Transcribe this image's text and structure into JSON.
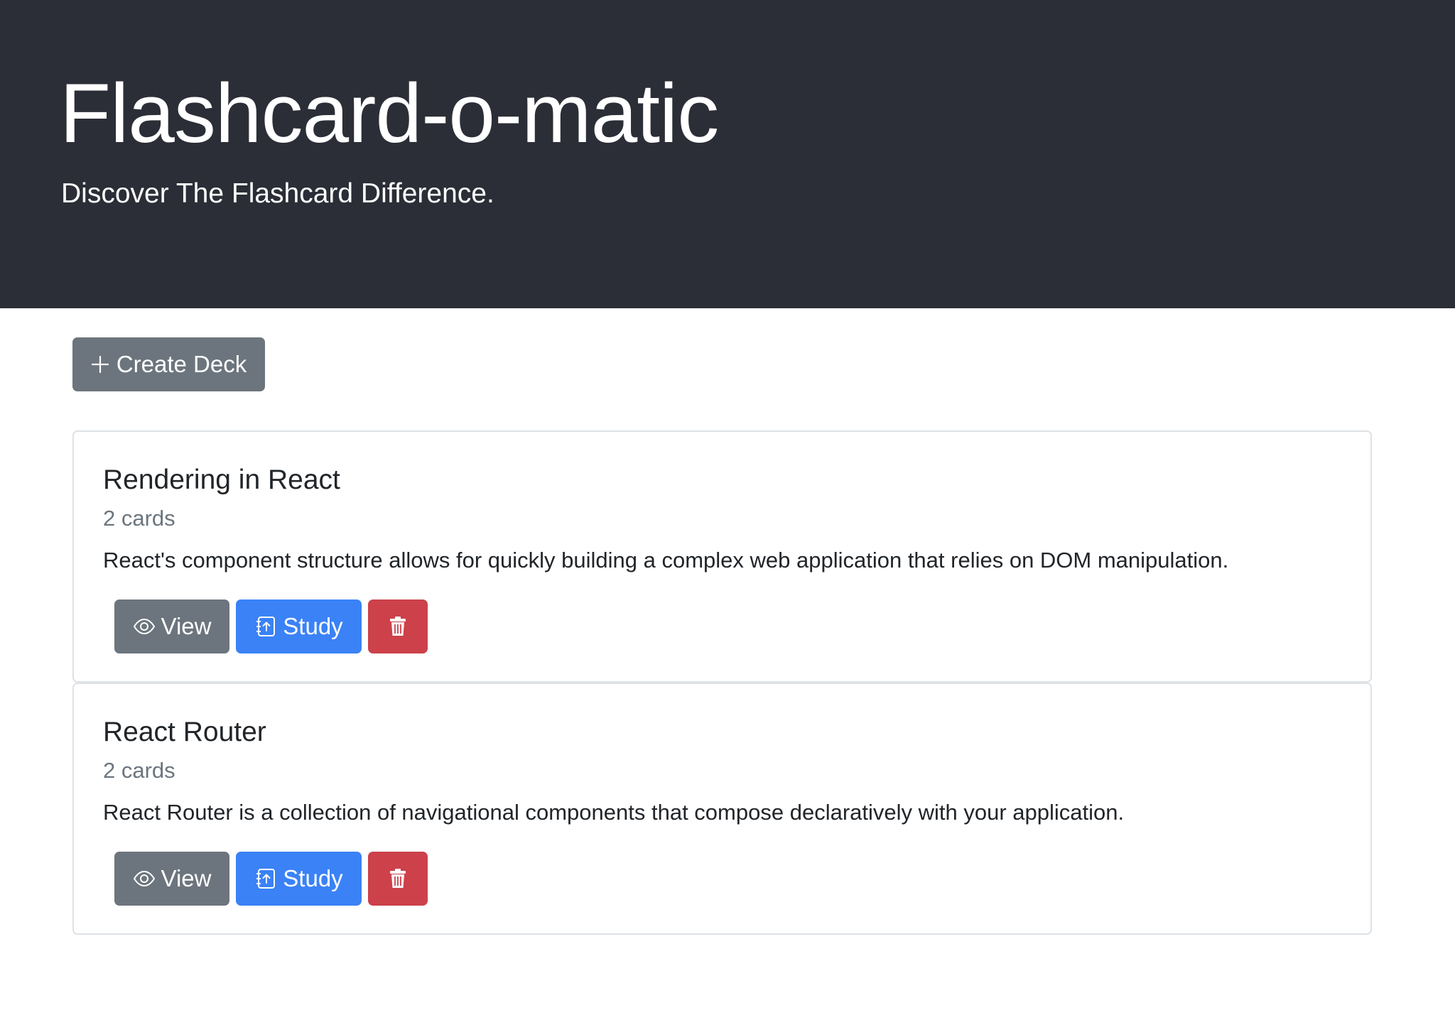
{
  "header": {
    "title": "Flashcard-o-matic",
    "subtitle": "Discover The Flashcard Difference."
  },
  "toolbar": {
    "create_label": "Create Deck",
    "create_icon": "plus-icon"
  },
  "colors": {
    "header_background": "#2b2e36",
    "secondary": "#6c757d",
    "primary": "#3a82f6",
    "danger": "#cc414a"
  },
  "decks": [
    {
      "name": "Rendering in React",
      "count": "2 cards",
      "description": "React's component structure allows for quickly building a complex web application that relies on DOM manipulation.",
      "view_label": "View",
      "study_label": "Study",
      "delete_icon": "trash-icon"
    },
    {
      "name": "React Router",
      "count": "2 cards",
      "description": "React Router is a collection of navigational components that compose declaratively with your application.",
      "view_label": "View",
      "study_label": "Study",
      "delete_icon": "trash-icon"
    }
  ]
}
